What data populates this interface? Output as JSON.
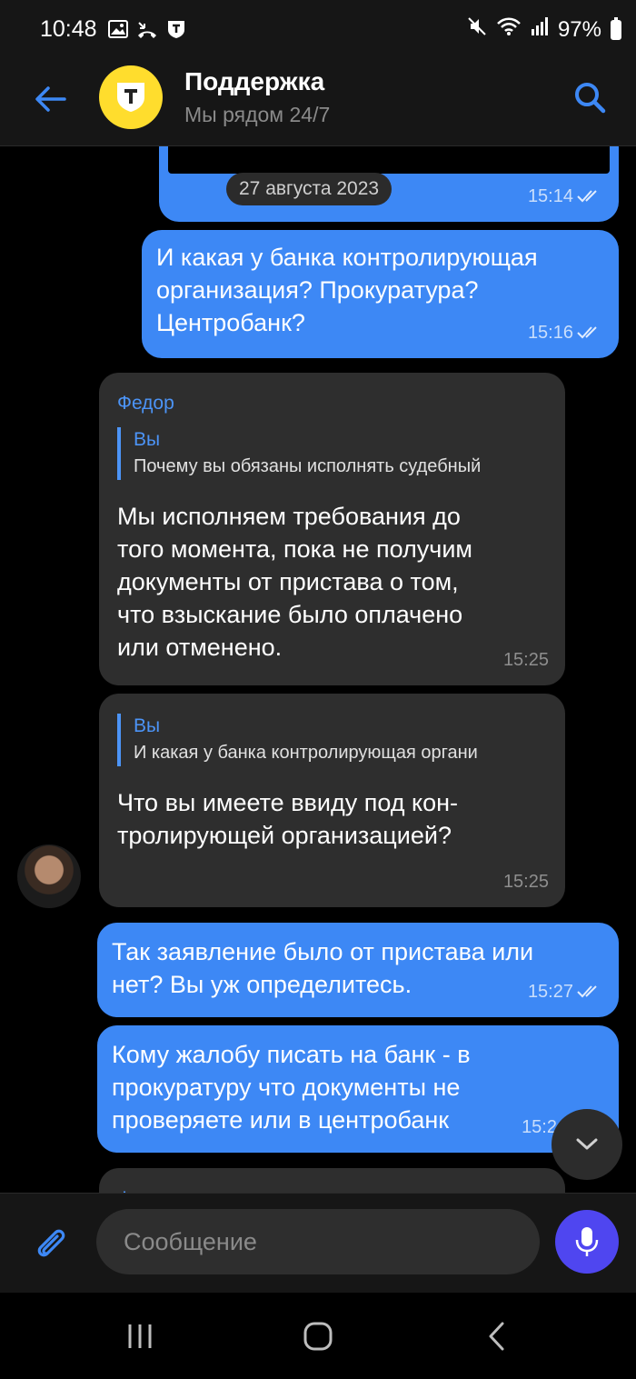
{
  "status_bar": {
    "time": "10:48",
    "battery": "97%",
    "icons": [
      "gallery-icon",
      "missed-call-icon",
      "tbank-icon",
      "mute-icon",
      "wifi-icon",
      "signal-icon",
      "battery-icon"
    ]
  },
  "header": {
    "title": "Поддержка",
    "subtitle": "Мы рядом 24/7",
    "accent_color": "#3d88f5",
    "logo_color": "#ffdd2d"
  },
  "messages": [
    {
      "direction": "outgoing",
      "date_label": "27 августа 2023",
      "time": "15:14",
      "read": true
    },
    {
      "direction": "outgoing",
      "lines": [
        "И какая у банка контролирующая",
        "организация? Прокуратура?",
        "Центробанк?"
      ],
      "time": "15:16",
      "read": true
    },
    {
      "direction": "incoming",
      "sender": "Федор",
      "reply": {
        "author": "Вы",
        "text": "Почему вы обязаны исполнять судебный"
      },
      "lines": [
        "Мы исполняем требования до",
        "того момента, пока не получим",
        "документы от пристава о том,",
        "что взыскание было оплачено",
        "или отменено."
      ],
      "time": "15:25"
    },
    {
      "direction": "incoming",
      "reply": {
        "author": "Вы",
        "text": "И какая у банка контролирующая органи"
      },
      "lines": [
        "Что вы имеете ввиду под кон-",
        "тролирующей организацией?"
      ],
      "time": "15:25"
    },
    {
      "direction": "outgoing",
      "lines": [
        "Так заявление было от пристава или",
        "нет? Вы уж определитесь."
      ],
      "time": "15:27",
      "read": true
    },
    {
      "direction": "outgoing",
      "lines": [
        "Кому жалобу писать на банк - в",
        "прокуратуру что документы не",
        "проверяете или в центробанк"
      ],
      "time": "15:2"
    },
    {
      "direction": "incoming",
      "sender": "Федор"
    }
  ],
  "composer": {
    "placeholder": "Сообщение"
  }
}
